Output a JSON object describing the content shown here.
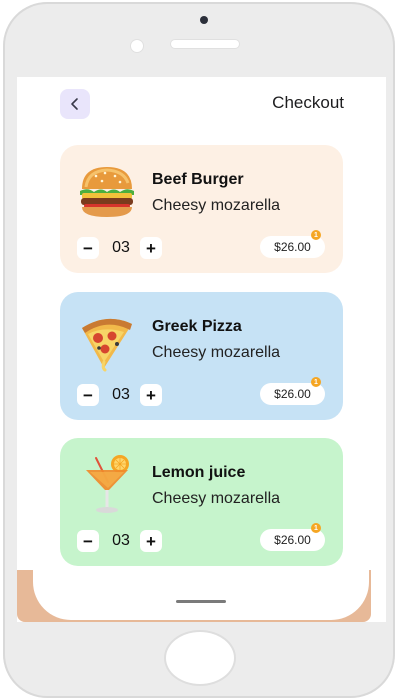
{
  "header": {
    "title": "Checkout"
  },
  "items": [
    {
      "name": "Beef Burger",
      "description": "Cheesy mozarella",
      "quantity": "03",
      "price": "$26.00",
      "badge": "1",
      "icon": "burger-icon"
    },
    {
      "name": "Greek Pizza",
      "description": "Cheesy mozarella",
      "quantity": "03",
      "price": "$26.00",
      "badge": "1",
      "icon": "pizza-icon"
    },
    {
      "name": "Lemon juice",
      "description": "Cheesy mozarella",
      "quantity": "03",
      "price": "$26.00",
      "badge": "1",
      "icon": "cocktail-icon"
    }
  ],
  "controls": {
    "minus": "−",
    "plus": "+"
  },
  "colors": {
    "card_burger": "#fdf0e4",
    "card_pizza": "#c6e2f5",
    "card_juice": "#c6f4cc",
    "back_button": "#e9e5fb",
    "badge": "#f5a623"
  }
}
